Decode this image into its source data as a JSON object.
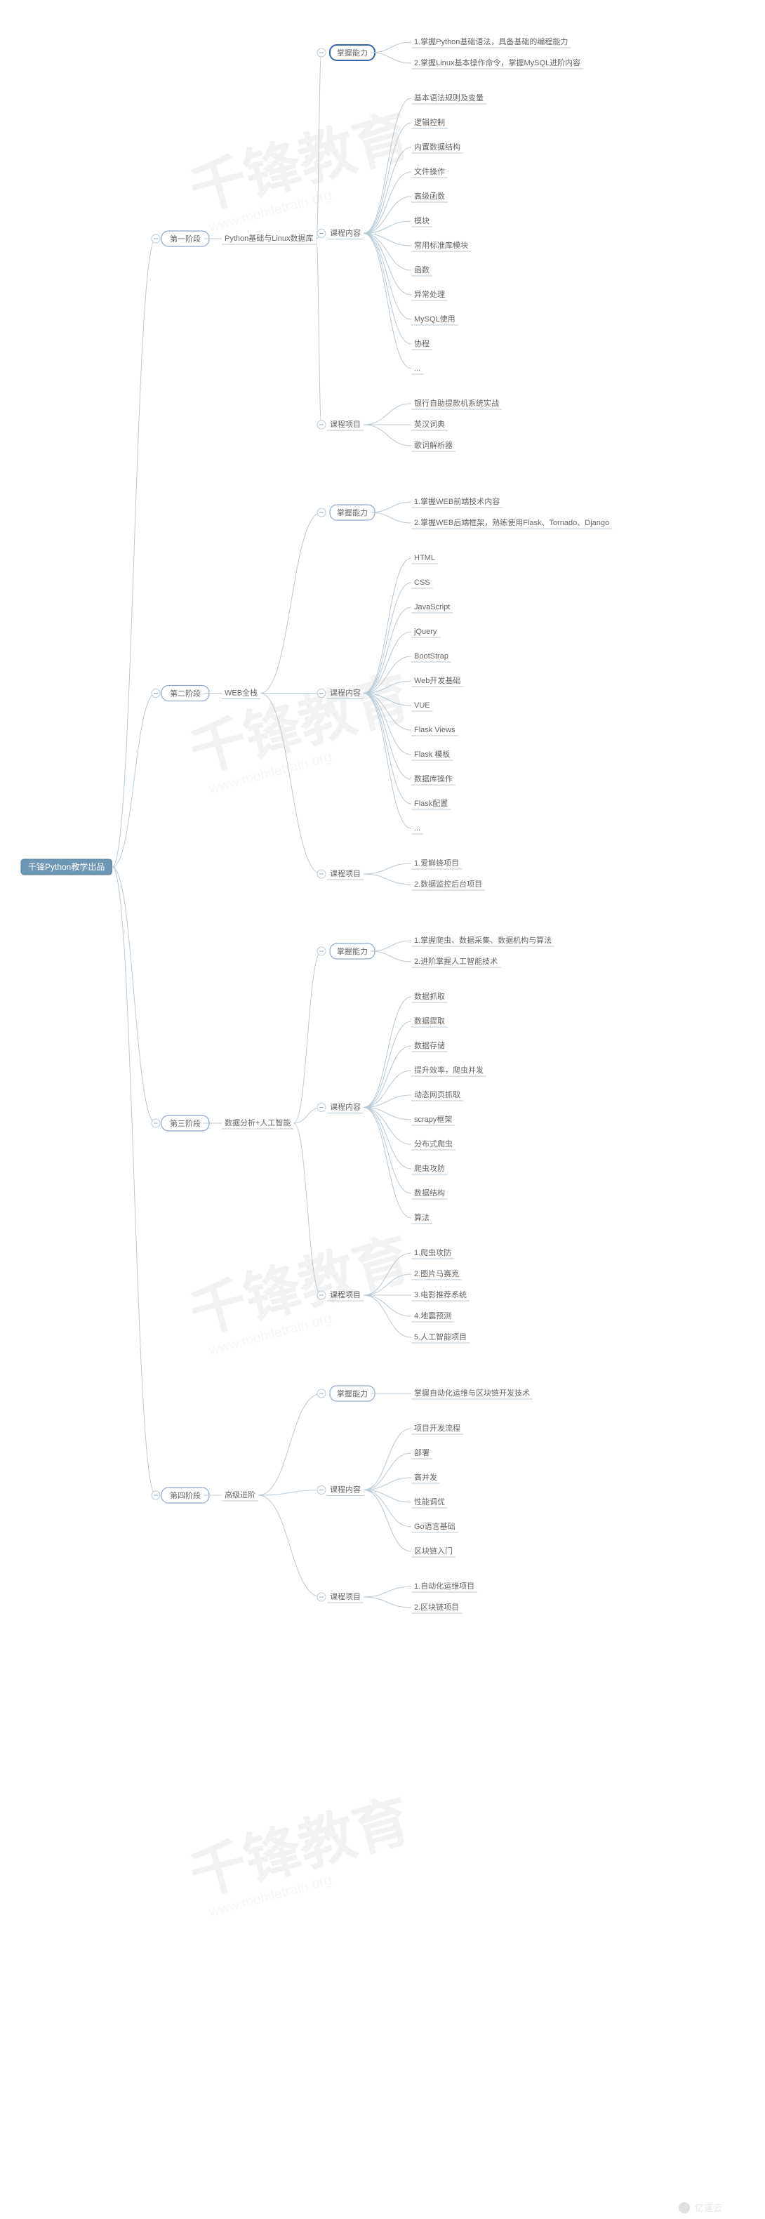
{
  "root_label": "千锋Python教学出品",
  "watermark_main": "千锋教育",
  "watermark_sub": "www.mobiletrain.org",
  "footer_brand": "亿速云",
  "stages": [
    {
      "label": "第一阶段",
      "sub": "Python基础与Linux数据库",
      "hl": true,
      "ability_label": "掌握能力",
      "ability": [
        "1.掌握Python基础语法，具备基础的编程能力",
        "2.掌握Linux基本操作命令，掌握MySQL进阶内容"
      ],
      "content_label": "课程内容",
      "content": [
        "基本语法规则及变量",
        "逻辑控制",
        "内置数据结构",
        "文件操作",
        "高级函数",
        "模块",
        "常用标准库模块",
        "函数",
        "异常处理",
        "MySQL使用",
        "协程",
        "..."
      ],
      "project_label": "课程项目",
      "project": [
        "银行自助提款机系统实战",
        "英汉词典",
        "歌词解析器"
      ]
    },
    {
      "label": "第二阶段",
      "sub": "WEB全栈",
      "hl": false,
      "ability_label": "掌握能力",
      "ability": [
        "1.掌握WEB前端技术内容",
        "2.掌握WEB后端框架，熟练使用Flask、Tornado、Django"
      ],
      "content_label": "课程内容",
      "content": [
        "HTML",
        "CSS",
        "JavaScript",
        "jQuery",
        "BootStrap",
        "Web开发基础",
        "VUE",
        "Flask Views",
        "Flask 模板",
        "数据库操作",
        "Flask配置",
        "..."
      ],
      "project_label": "课程项目",
      "project": [
        "1.爱鲜蜂项目",
        "2.数据监控后台项目"
      ]
    },
    {
      "label": "第三阶段",
      "sub": "数据分析+人工智能",
      "hl": false,
      "ability_label": "掌握能力",
      "ability": [
        "1.掌握爬虫、数据采集、数据机构与算法",
        "2.进阶掌握人工智能技术"
      ],
      "content_label": "课程内容",
      "content": [
        "数据抓取",
        "数据提取",
        "数据存储",
        "提升效率，爬虫并发",
        "动态网页抓取",
        "scrapy框架",
        "分布式爬虫",
        "爬虫攻防",
        "数据结构",
        "算法"
      ],
      "project_label": "课程项目",
      "project": [
        "1.爬虫攻防",
        "2.图片马赛克",
        "3.电影推荐系统",
        "4.地震预测",
        "5.人工智能项目"
      ]
    },
    {
      "label": "第四阶段",
      "sub": "高级进阶",
      "hl": false,
      "ability_label": "掌握能力",
      "ability": [
        "掌握自动化运维与区块链开发技术"
      ],
      "content_label": "课程内容",
      "content": [
        "项目开发流程",
        "部署",
        "高并发",
        "性能调优",
        "Go语言基础",
        "区块链入门"
      ],
      "project_label": "课程项目",
      "project": [
        "1.自动化运维项目",
        "2.区块链项目"
      ]
    }
  ]
}
